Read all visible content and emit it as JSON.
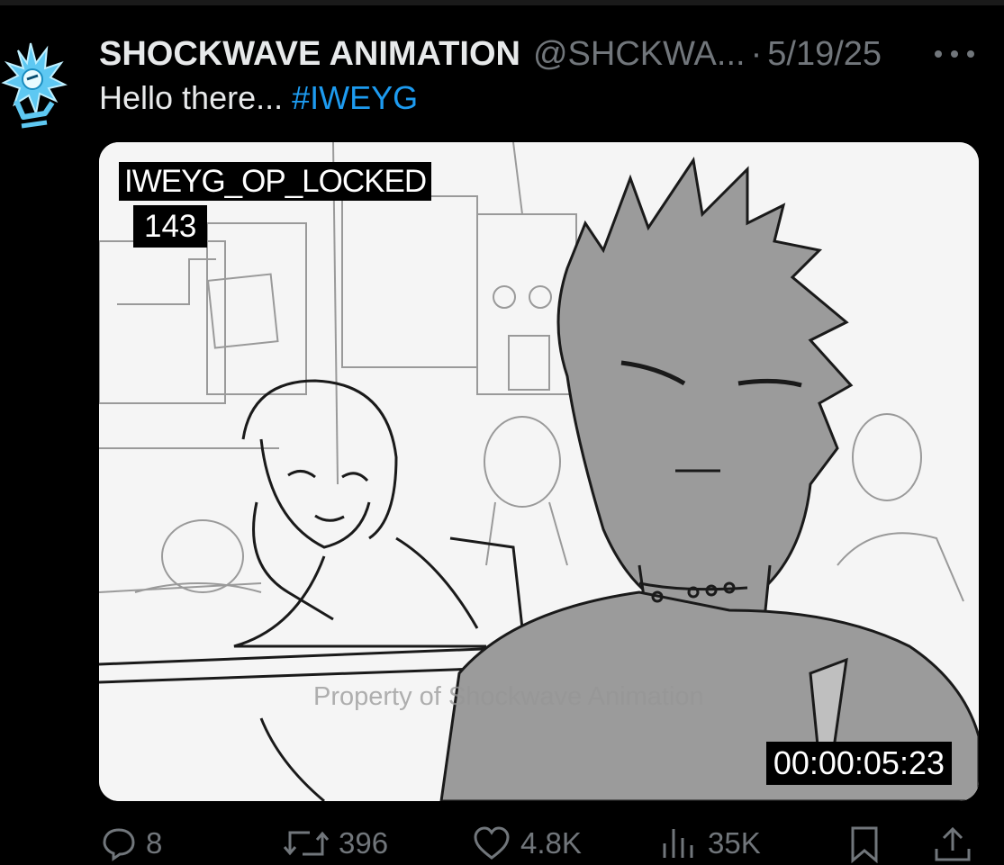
{
  "post": {
    "author_name": "SHOCKWAVE ANIMATION",
    "author_handle": "@SHCKWA...",
    "separator": "·",
    "date": "5/19/25",
    "text": "Hello there...",
    "hashtag": "#IWEYG",
    "more_icon": "more-horizontal-icon",
    "avatar_icon": "spiky-logo-icon"
  },
  "media": {
    "label_title": "IWEYG_OP_LOCKED",
    "label_frame": "143",
    "watermark": "Property of Shockwave Animation",
    "timecode": "00:00:05:23"
  },
  "actions": {
    "replies": "8",
    "reposts": "396",
    "likes": "4.8K",
    "views": "35K",
    "reply_icon": "reply-bubble-icon",
    "repost_icon": "repost-icon",
    "like_icon": "heart-icon",
    "views_icon": "views-bar-chart-icon",
    "bookmark_icon": "bookmark-icon",
    "share_icon": "share-upload-icon"
  },
  "colors": {
    "background": "#000000",
    "text_primary": "#e7e9ea",
    "text_secondary": "#71767b",
    "accent": "#1d9bf0"
  }
}
